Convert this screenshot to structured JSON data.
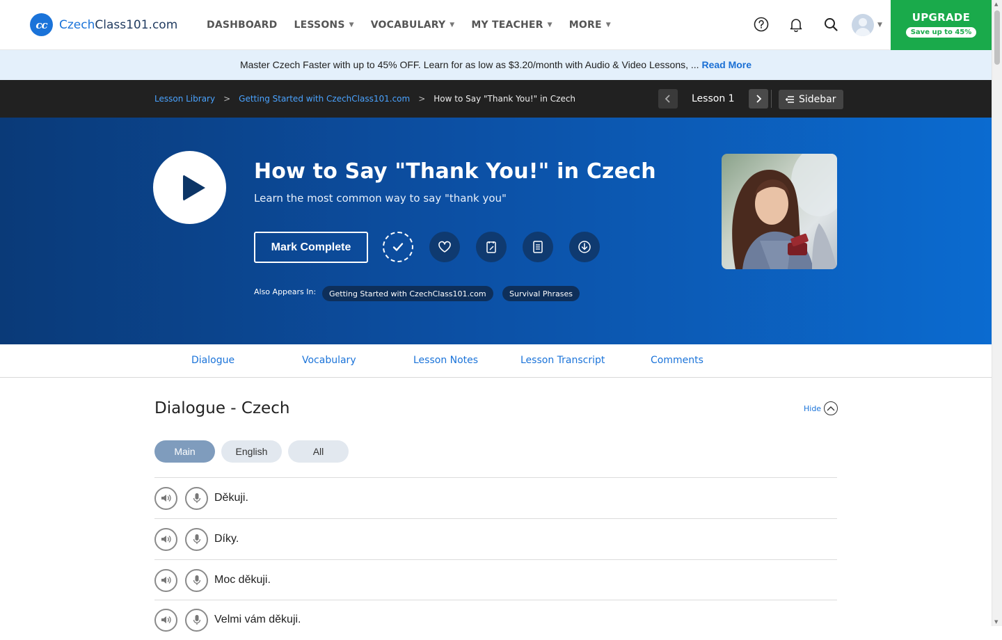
{
  "header": {
    "logo_mark": "cc",
    "logo_prefix": "Czech",
    "logo_suffix": "Class101.com",
    "nav": [
      "DASHBOARD",
      "LESSONS",
      "VOCABULARY",
      "MY TEACHER",
      "MORE"
    ],
    "upgrade_label": "UPGRADE",
    "upgrade_sub": "Save up to 45%",
    "icons": [
      "help-icon",
      "bell-icon",
      "search-icon"
    ],
    "accent": "#1a73d9",
    "upgrade_color": "#1aaa4b"
  },
  "promo": {
    "text": "Master Czech Faster with up to 45% OFF. Learn for as low as $3.20/month with Audio & Video Lessons, ...",
    "link": "Read More"
  },
  "breadcrumb": {
    "items": [
      "Lesson Library",
      "Getting Started with CzechClass101.com"
    ],
    "current": "How to Say \"Thank You!\" in Czech",
    "lesson_label": "Lesson 1",
    "sidebar_label": "Sidebar"
  },
  "hero": {
    "title": "How to Say \"Thank You!\" in Czech",
    "subtitle": "Learn the most common way to say \"thank you\"",
    "mark_complete": "Mark Complete",
    "also_label": "Also Appears In:",
    "also": [
      "Getting Started with CzechClass101.com",
      "Survival Phrases"
    ],
    "action_icons": [
      "check-icon",
      "heart-icon",
      "notes-icon",
      "pdf-icon",
      "download-icon"
    ]
  },
  "tabs": [
    "Dialogue",
    "Vocabulary",
    "Lesson Notes",
    "Lesson Transcript",
    "Comments"
  ],
  "dialogue": {
    "title": "Dialogue - Czech",
    "hide_label": "Hide",
    "segments": [
      "Main",
      "English",
      "All"
    ],
    "active_segment": "Main",
    "lines": [
      "Děkuji.",
      "Díky.",
      "Moc děkuji.",
      "Velmi vám děkuji."
    ]
  }
}
